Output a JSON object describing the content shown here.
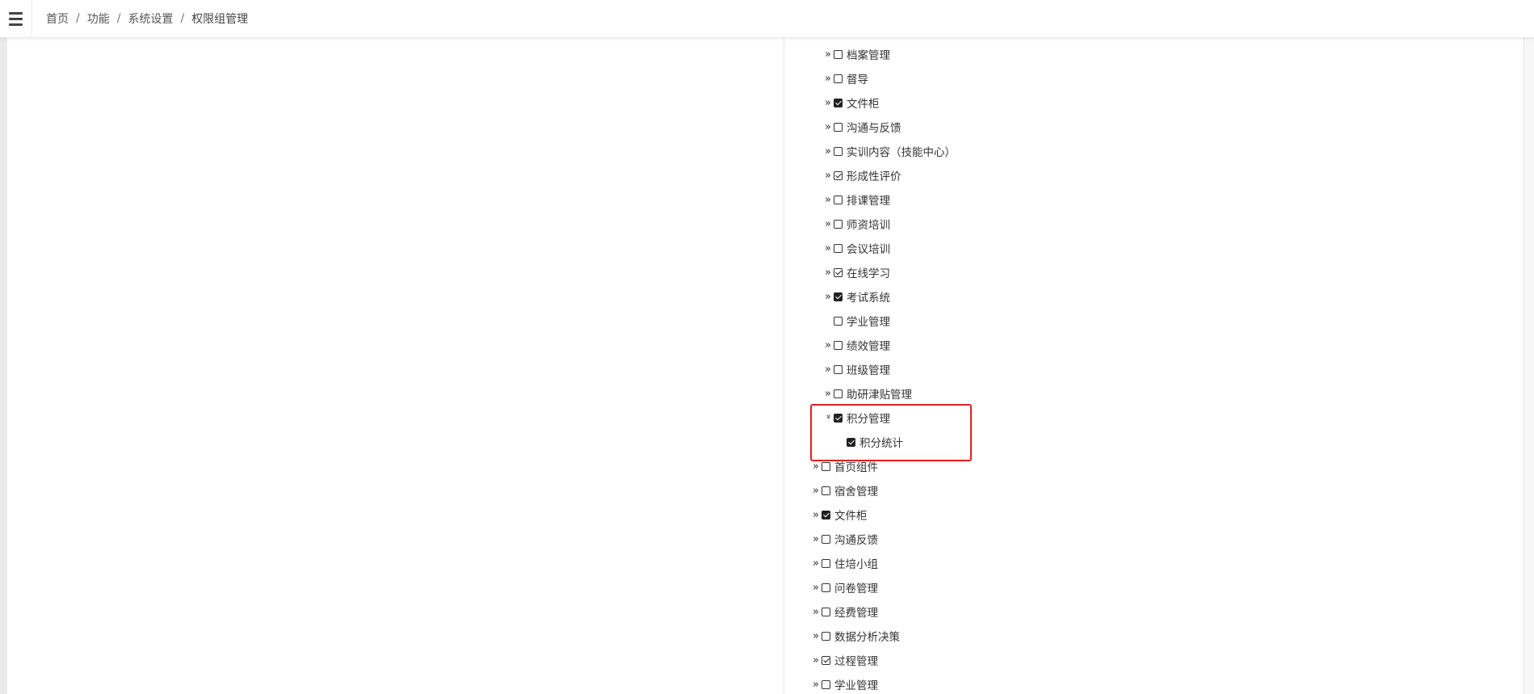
{
  "topbar": {
    "menu_icon": "hamburger-menu-icon",
    "breadcrumb": [
      "首页",
      "功能",
      "系统设置",
      "权限组管理"
    ],
    "separator": "/"
  },
  "tree": [
    {
      "label": "档案管理",
      "level": 1,
      "expander": "collapsed",
      "check": "unchecked"
    },
    {
      "label": "督导",
      "level": 1,
      "expander": "collapsed",
      "check": "unchecked"
    },
    {
      "label": "文件柜",
      "level": 1,
      "expander": "collapsed",
      "check": "checked"
    },
    {
      "label": "沟通与反馈",
      "level": 1,
      "expander": "collapsed",
      "check": "unchecked"
    },
    {
      "label": "实训内容（技能中心）",
      "level": 1,
      "expander": "collapsed",
      "check": "unchecked"
    },
    {
      "label": "形成性评价",
      "level": 1,
      "expander": "collapsed",
      "check": "partial"
    },
    {
      "label": "排课管理",
      "level": 1,
      "expander": "collapsed",
      "check": "unchecked"
    },
    {
      "label": "师资培训",
      "level": 1,
      "expander": "collapsed",
      "check": "unchecked"
    },
    {
      "label": "会议培训",
      "level": 1,
      "expander": "collapsed",
      "check": "unchecked"
    },
    {
      "label": "在线学习",
      "level": 1,
      "expander": "collapsed",
      "check": "partial"
    },
    {
      "label": "考试系统",
      "level": 1,
      "expander": "collapsed",
      "check": "checked"
    },
    {
      "label": "学业管理",
      "level": 1,
      "expander": "none",
      "check": "unchecked"
    },
    {
      "label": "绩效管理",
      "level": 1,
      "expander": "collapsed",
      "check": "unchecked"
    },
    {
      "label": "班级管理",
      "level": 1,
      "expander": "collapsed",
      "check": "unchecked"
    },
    {
      "label": "助研津贴管理",
      "level": 1,
      "expander": "collapsed",
      "check": "unchecked"
    },
    {
      "label": "积分管理",
      "level": 1,
      "expander": "expanded",
      "check": "checked"
    },
    {
      "label": "积分统计",
      "level": 2,
      "expander": "none",
      "check": "checked"
    },
    {
      "label": "首页组件",
      "level": 0,
      "expander": "collapsed",
      "check": "unchecked"
    },
    {
      "label": "宿舍管理",
      "level": 0,
      "expander": "collapsed",
      "check": "unchecked"
    },
    {
      "label": "文件柜",
      "level": 0,
      "expander": "collapsed",
      "check": "checked"
    },
    {
      "label": "沟通反馈",
      "level": 0,
      "expander": "collapsed",
      "check": "unchecked"
    },
    {
      "label": "住培小组",
      "level": 0,
      "expander": "collapsed",
      "check": "unchecked"
    },
    {
      "label": "问卷管理",
      "level": 0,
      "expander": "collapsed",
      "check": "unchecked"
    },
    {
      "label": "经费管理",
      "level": 0,
      "expander": "collapsed",
      "check": "unchecked"
    },
    {
      "label": "数据分析决策",
      "level": 0,
      "expander": "collapsed",
      "check": "unchecked"
    },
    {
      "label": "过程管理",
      "level": 0,
      "expander": "collapsed",
      "check": "partial"
    },
    {
      "label": "学业管理",
      "level": 0,
      "expander": "collapsed",
      "check": "unchecked"
    }
  ],
  "highlight_color": "#e02020",
  "icons": {
    "collapsed": "double-chevron-right-icon",
    "expanded": "double-chevron-down-icon"
  }
}
